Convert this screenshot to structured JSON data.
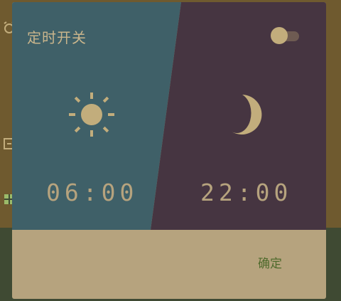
{
  "dialog": {
    "title": "定时开关",
    "toggle_on": true,
    "start_time": "06:00",
    "end_time": "22:00",
    "sun_icon": "sun-icon",
    "moon_icon": "moon-icon",
    "confirm_label": "确定"
  },
  "colors": {
    "day_panel": "#3f6068",
    "night_panel": "#463541",
    "dialog_footer": "#b6a37e",
    "accent_gold": "#c2ad7c",
    "confirm_text": "#4f6a2c"
  }
}
